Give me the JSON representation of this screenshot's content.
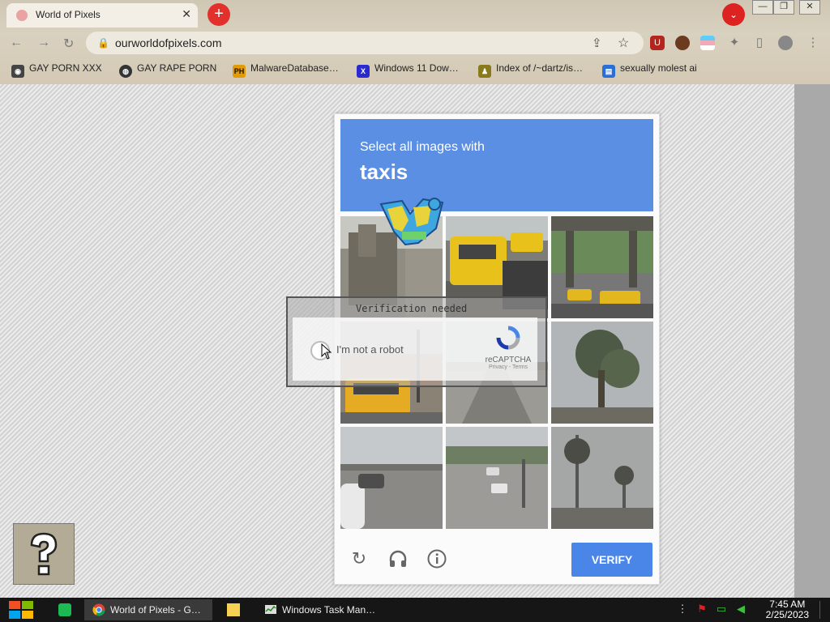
{
  "browser": {
    "tab_title": "World of Pixels",
    "tab_close": "✕",
    "new_tab": "+",
    "tab_search": "⌄",
    "url": "ourworldofpixels.com",
    "window_controls": [
      "—",
      "❐",
      "✕"
    ]
  },
  "bookmarks": [
    {
      "label": "GAY PORN XXX",
      "icon": "discord-icon",
      "color": "#444444"
    },
    {
      "label": "GAY RAPE PORN",
      "icon": "globe-icon",
      "color": "#333333"
    },
    {
      "label": "MalwareDatabase…",
      "icon": "ph-icon",
      "color": "#e29b00"
    },
    {
      "label": "Windows 11 Dow…",
      "icon": "x-icon",
      "color": "#2a2ad0"
    },
    {
      "label": "Index of /~dartz/is…",
      "icon": "folder-person-icon",
      "color": "#8a7a1c"
    },
    {
      "label": "sexually molest ai",
      "icon": "doc-icon",
      "color": "#2a6fd6"
    }
  ],
  "captcha": {
    "instruction": "Select all images with",
    "target": "taxis",
    "verify_label": "VERIFY",
    "footer_icons": [
      "reload-icon",
      "headphones-icon",
      "info-icon"
    ]
  },
  "overlay": {
    "title": "Verification needed",
    "checkbox_label": "I'm not a robot",
    "brand": "reCAPTCHA",
    "brand_sub": "Privacy - Terms"
  },
  "taskbar": {
    "items": [
      {
        "label": "World of Pixels - G…",
        "icon": "chrome-icon"
      },
      {
        "label": "Windows Task Man…",
        "icon": "task-manager-icon"
      }
    ],
    "time": "7:45 AM",
    "date": "2/25/2023"
  },
  "colors": {
    "captcha_header": "#5b8fe3",
    "verify_button": "#4a86e8",
    "new_tab_button": "#e2312c"
  }
}
